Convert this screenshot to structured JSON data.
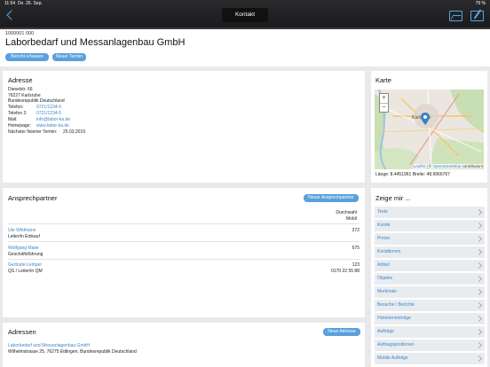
{
  "status": {
    "time": "11:54",
    "date": "Do. 26. Sep.",
    "battery": "79 %"
  },
  "nav": {
    "title": "Kontakt"
  },
  "customer": {
    "number": "1000001 000",
    "name": "Laborbedarf und Messanlagenbau GmbH",
    "report_button": "Bericht erfassen",
    "appointment_button": "Neuer Termin"
  },
  "address_card": {
    "title": "Adresse",
    "street": "Dieselstr. 66",
    "city": "76227 Karlsruhe",
    "country": "Bundesrepublik Deutschland",
    "phone_label": "Telefon:",
    "phone": "0721/1234-0",
    "phone2_label": "Telefon 2:",
    "phone2": "0721/1234-5",
    "mail_label": "Mail:",
    "mail": "info@labor-ka.de",
    "homepage_label": "Homepage:",
    "homepage": "www.labor-ka.de",
    "next_label": "Nächster fixierter Termin:",
    "next_value": "25.03.2019"
  },
  "map_card": {
    "title": "Karte",
    "zoom_in": "+",
    "zoom_out": "−",
    "attribution_leaflet": "Leaflet",
    "attribution_sep": " | © ",
    "attribution_osm": "OpenStreetMap",
    "attribution_tail": " contributors",
    "coords": "Länge:  8.4451961   Breite:  48.9966767",
    "city_label": "Karlsruhe"
  },
  "contacts": {
    "title": "Ansprechpartner",
    "new_button": "Neuer Ansprechpartner",
    "col_head_1": "Durchwahl",
    "col_head_2": "Mobil",
    "people": [
      {
        "name": "Ute Wildmann",
        "role": "Leiter/in Einkauf",
        "ext": "272",
        "mobile": ""
      },
      {
        "name": "Wolfgang Maier",
        "role": "Geschäftsführung",
        "ext": "675",
        "mobile": ""
      },
      {
        "name": "Gertrude Lemper",
        "role": "QS / Leiter/in QM",
        "ext": "123",
        "mobile": "0170 22 55 88"
      }
    ]
  },
  "addresses": {
    "title": "Adressen",
    "new_button": "Neue Adresse",
    "item_name": "Laborbedarf und Messanlagenbau GmbH",
    "item_addr": "Wilhelmstrasse 25, 76275 Ettlingen, Bundesrepublik Deutschland"
  },
  "showme": {
    "title": "Zeige mir ...",
    "items": [
      "Texte",
      "Kunde",
      "Preise",
      "Konditionen",
      "Artikel",
      "Objekte",
      "Merkmale",
      "Besuche / Berichte",
      "Historieneinträge",
      "Aufträge",
      "Auftragspositionen",
      "Mobile Aufträge"
    ]
  },
  "colors": {
    "accent": "#5aa0dc",
    "link": "#3f86c9",
    "navbar": "#1f1f22"
  }
}
